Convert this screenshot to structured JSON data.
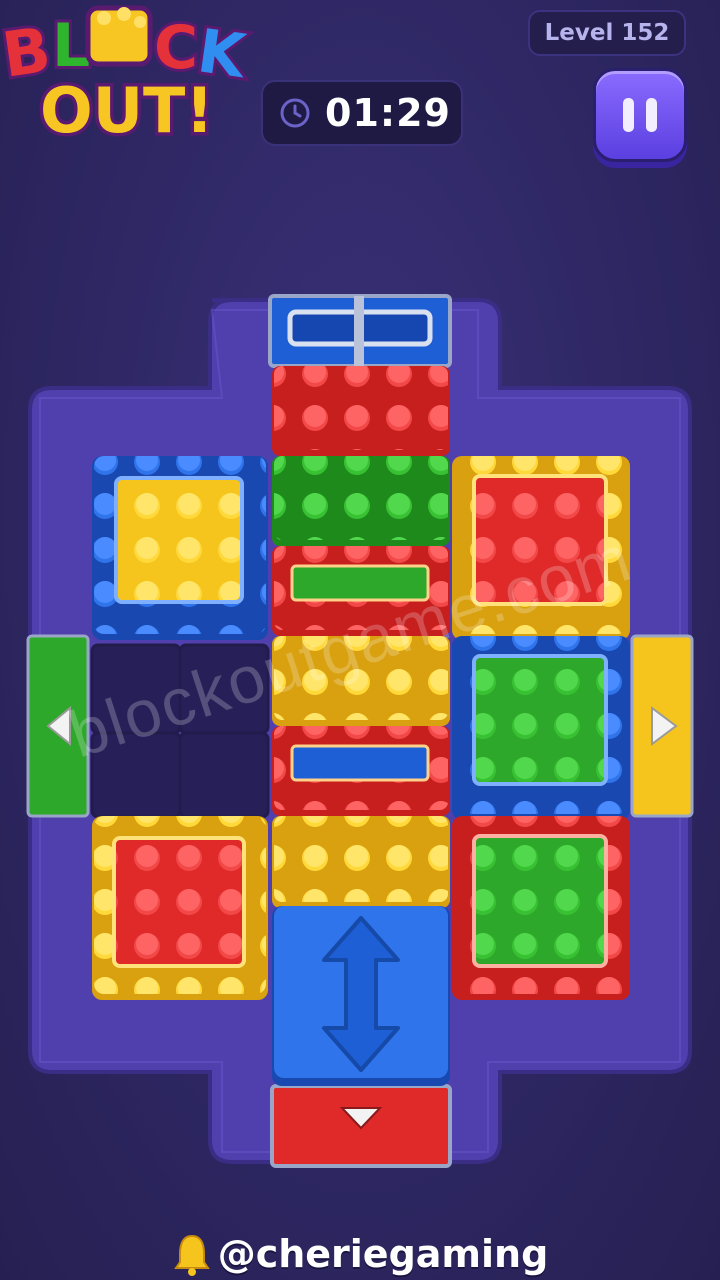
{
  "game": {
    "logo_line1": "BLOCK",
    "logo_line2": "OUT!",
    "level_label": "Level 152",
    "timer": "01:29",
    "pause_icon": "pause-icon"
  },
  "board": {
    "colors": {
      "red": "#e02a2a",
      "green": "#2ea82a",
      "blue": "#1f5fd6",
      "yellow": "#f5c51e",
      "frame": "#4e3aa6"
    },
    "exits": [
      {
        "color": "blue",
        "side": "top"
      },
      {
        "color": "green",
        "side": "left"
      },
      {
        "color": "yellow",
        "side": "right"
      },
      {
        "color": "red",
        "side": "bottom"
      }
    ],
    "blocks": [
      {
        "name": "red-bar-top",
        "color": "red"
      },
      {
        "name": "green-bar",
        "color": "green"
      },
      {
        "name": "red-frame-green-bar",
        "color": "red",
        "inner": "green"
      },
      {
        "name": "yellow-bar",
        "color": "yellow"
      },
      {
        "name": "red-frame-blue-bar",
        "color": "red",
        "inner": "blue"
      },
      {
        "name": "yellow-bar-lower",
        "color": "yellow"
      },
      {
        "name": "blue-frame-yellow",
        "color": "blue",
        "inner": "yellow"
      },
      {
        "name": "yellow-frame-red",
        "color": "yellow",
        "inner": "red"
      },
      {
        "name": "blue-frame-green",
        "color": "blue",
        "inner": "green"
      },
      {
        "name": "yellow-frame-red-lower",
        "color": "yellow",
        "inner": "red"
      },
      {
        "name": "red-frame-green",
        "color": "red",
        "inner": "green"
      },
      {
        "name": "blue-vertical-mover",
        "color": "blue"
      }
    ]
  },
  "watermark": "blockoutgame.com",
  "footer": {
    "handle": "@cheriegaming",
    "icon": "bell-icon"
  }
}
